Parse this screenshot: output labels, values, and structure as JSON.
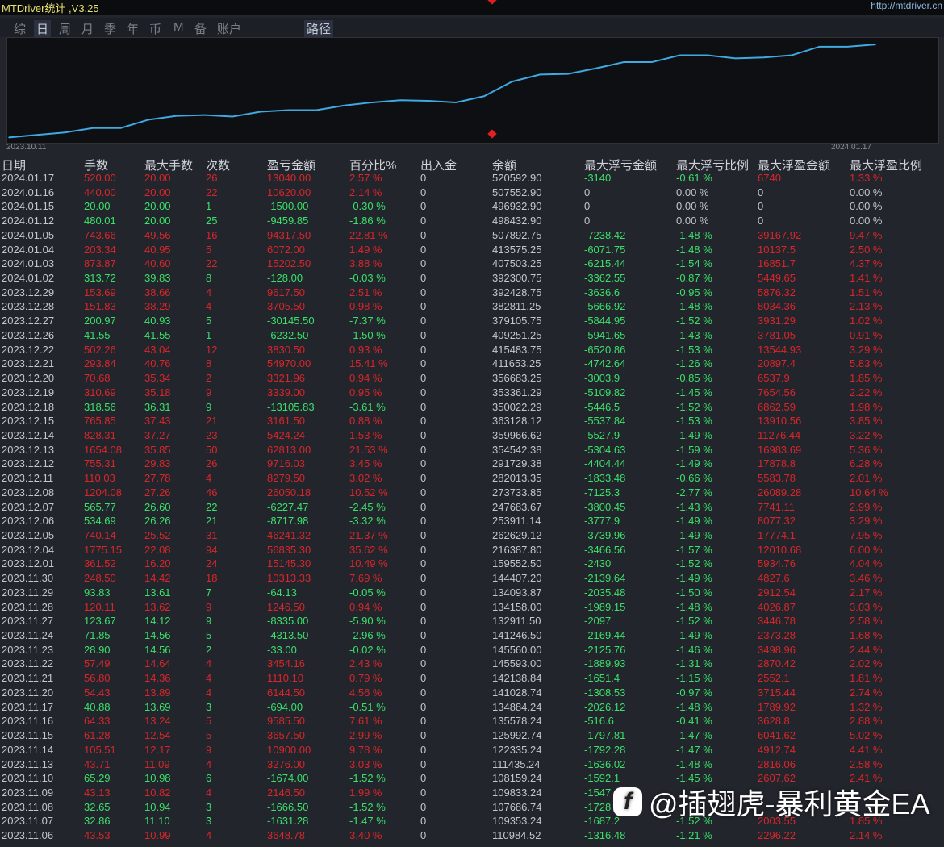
{
  "app": {
    "title": "MTDriver统计 ,V3.25",
    "link": "http://mtdriver.cn"
  },
  "tabs": [
    {
      "label": "综"
    },
    {
      "label": "日",
      "active": true
    },
    {
      "label": "周"
    },
    {
      "label": "月"
    },
    {
      "label": "季"
    },
    {
      "label": "年"
    },
    {
      "label": "币"
    },
    {
      "label": "M"
    },
    {
      "label": "备"
    },
    {
      "label": "账户"
    },
    {
      "label": "路径",
      "active": true
    }
  ],
  "chart_data": {
    "type": "line",
    "title": "",
    "xlabel": "",
    "ylabel": "余额",
    "x_start": "2023.10.11",
    "x_end": "2024.01.17",
    "line_color": "#3fa9e0",
    "values": [
      89500,
      101000,
      112000,
      132000,
      132000,
      170000,
      187000,
      191000,
      184000,
      206000,
      213000,
      213000,
      234000,
      248000,
      258000,
      255000,
      248000,
      276000,
      342000,
      374000,
      377000,
      402000,
      430000,
      430000,
      461000,
      461000,
      447000,
      451000,
      461000,
      500000,
      500000,
      510000
    ]
  },
  "watermark": "@插翅虎-暴利黄金EA",
  "table": {
    "headers": [
      "日期",
      "手数",
      "最大手数",
      "次数",
      "盈亏金额",
      "百分比%",
      "出入金",
      "余额",
      "最大浮亏金额",
      "最大浮亏比例",
      "最大浮盈金额",
      "最大浮盈比例"
    ],
    "rows": [
      [
        "2024.01.17",
        "520.00",
        "20.00",
        "26",
        "13040.00",
        "2.57 %",
        "0",
        "520592.90",
        "-3140",
        "-0.61 %",
        "6740",
        "1.33 %"
      ],
      [
        "2024.01.16",
        "440.00",
        "20.00",
        "22",
        "10620.00",
        "2.14 %",
        "0",
        "507552.90",
        "0",
        "0.00 %",
        "0",
        "0.00 %"
      ],
      [
        "2024.01.15",
        "20.00",
        "20.00",
        "1",
        "-1500.00",
        "-0.30 %",
        "0",
        "496932.90",
        "0",
        "0.00 %",
        "0",
        "0.00 %"
      ],
      [
        "2024.01.12",
        "480.01",
        "20.00",
        "25",
        "-9459.85",
        "-1.86 %",
        "0",
        "498432.90",
        "0",
        "0.00 %",
        "0",
        "0.00 %"
      ],
      [
        "2024.01.05",
        "743.66",
        "49.56",
        "16",
        "94317.50",
        "22.81 %",
        "0",
        "507892.75",
        "-7238.42",
        "-1.48 %",
        "39167.92",
        "9.47 %"
      ],
      [
        "2024.01.04",
        "203.34",
        "40.95",
        "5",
        "6072.00",
        "1.49 %",
        "0",
        "413575.25",
        "-6071.75",
        "-1.48 %",
        "10137.5",
        "2.50 %"
      ],
      [
        "2024.01.03",
        "873.87",
        "40.60",
        "22",
        "15202.50",
        "3.88 %",
        "0",
        "407503.25",
        "-6215.44",
        "-1.54 %",
        "16851.7",
        "4.37 %"
      ],
      [
        "2024.01.02",
        "313.72",
        "39.83",
        "8",
        "-128.00",
        "-0.03 %",
        "0",
        "392300.75",
        "-3362.55",
        "-0.87 %",
        "5449.65",
        "1.41 %"
      ],
      [
        "2023.12.29",
        "153.69",
        "38.66",
        "4",
        "9617.50",
        "2.51 %",
        "0",
        "392428.75",
        "-3636.6",
        "-0.95 %",
        "5876.32",
        "1.51 %"
      ],
      [
        "2023.12.28",
        "151.83",
        "38.29",
        "4",
        "3705.50",
        "0.98 %",
        "0",
        "382811.25",
        "-5666.92",
        "-1.48 %",
        "8034.36",
        "2.13 %"
      ],
      [
        "2023.12.27",
        "200.97",
        "40.93",
        "5",
        "-30145.50",
        "-7.37 %",
        "0",
        "379105.75",
        "-5844.95",
        "-1.52 %",
        "3931.29",
        "1.02 %"
      ],
      [
        "2023.12.26",
        "41.55",
        "41.55",
        "1",
        "-6232.50",
        "-1.50 %",
        "0",
        "409251.25",
        "-5941.65",
        "-1.43 %",
        "3781.05",
        "0.91 %"
      ],
      [
        "2023.12.22",
        "502.26",
        "43.04",
        "12",
        "3830.50",
        "0.93 %",
        "0",
        "415483.75",
        "-6520.86",
        "-1.53 %",
        "13544.93",
        "3.29 %"
      ],
      [
        "2023.12.21",
        "293.84",
        "40.76",
        "8",
        "54970.00",
        "15.41 %",
        "0",
        "411653.25",
        "-4742.64",
        "-1.26 %",
        "20897.4",
        "5.83 %"
      ],
      [
        "2023.12.20",
        "70.68",
        "35.34",
        "2",
        "3321.96",
        "0.94 %",
        "0",
        "356683.25",
        "-3003.9",
        "-0.85 %",
        "6537.9",
        "1.85 %"
      ],
      [
        "2023.12.19",
        "310.69",
        "35.18",
        "9",
        "3339.00",
        "0.95 %",
        "0",
        "353361.29",
        "-5109.82",
        "-1.45 %",
        "7654.56",
        "2.22 %"
      ],
      [
        "2023.12.18",
        "318.56",
        "36.31",
        "9",
        "-13105.83",
        "-3.61 %",
        "0",
        "350022.29",
        "-5446.5",
        "-1.52 %",
        "6862.59",
        "1.98 %"
      ],
      [
        "2023.12.15",
        "765.85",
        "37.43",
        "21",
        "3161.50",
        "0.88 %",
        "0",
        "363128.12",
        "-5537.84",
        "-1.53 %",
        "13910.56",
        "3.85 %"
      ],
      [
        "2023.12.14",
        "828.31",
        "37.27",
        "23",
        "5424.24",
        "1.53 %",
        "0",
        "359966.62",
        "-5527.9",
        "-1.49 %",
        "11276.44",
        "3.22 %"
      ],
      [
        "2023.12.13",
        "1654.08",
        "35.85",
        "50",
        "62813.00",
        "21.53 %",
        "0",
        "354542.38",
        "-5304.63",
        "-1.59 %",
        "16983.69",
        "5.36 %"
      ],
      [
        "2023.12.12",
        "755.31",
        "29.83",
        "26",
        "9716.03",
        "3.45 %",
        "0",
        "291729.38",
        "-4404.44",
        "-1.49 %",
        "17878.8",
        "6.28 %"
      ],
      [
        "2023.12.11",
        "110.03",
        "27.78",
        "4",
        "8279.50",
        "3.02 %",
        "0",
        "282013.35",
        "-1833.48",
        "-0.66 %",
        "5583.78",
        "2.01 %"
      ],
      [
        "2023.12.08",
        "1204.08",
        "27.26",
        "46",
        "26050.18",
        "10.52 %",
        "0",
        "273733.85",
        "-7125.3",
        "-2.77 %",
        "26089.28",
        "10.64 %"
      ],
      [
        "2023.12.07",
        "565.77",
        "26.60",
        "22",
        "-6227.47",
        "-2.45 %",
        "0",
        "247683.67",
        "-3800.45",
        "-1.43 %",
        "7741.11",
        "2.99 %"
      ],
      [
        "2023.12.06",
        "534.69",
        "26.26",
        "21",
        "-8717.98",
        "-3.32 %",
        "0",
        "253911.14",
        "-3777.9",
        "-1.49 %",
        "8077.32",
        "3.29 %"
      ],
      [
        "2023.12.05",
        "740.14",
        "25.52",
        "31",
        "46241.32",
        "21.37 %",
        "0",
        "262629.12",
        "-3739.96",
        "-1.49 %",
        "17774.1",
        "7.95 %"
      ],
      [
        "2023.12.04",
        "1775.15",
        "22.08",
        "94",
        "56835.30",
        "35.62 %",
        "0",
        "216387.80",
        "-3466.56",
        "-1.57 %",
        "12010.68",
        "6.00 %"
      ],
      [
        "2023.12.01",
        "361.52",
        "16.20",
        "24",
        "15145.30",
        "10.49 %",
        "0",
        "159552.50",
        "-2430",
        "-1.52 %",
        "5934.76",
        "4.04 %"
      ],
      [
        "2023.11.30",
        "248.50",
        "14.42",
        "18",
        "10313.33",
        "7.69 %",
        "0",
        "144407.20",
        "-2139.64",
        "-1.49 %",
        "4827.6",
        "3.46 %"
      ],
      [
        "2023.11.29",
        "93.83",
        "13.61",
        "7",
        "-64.13",
        "-0.05 %",
        "0",
        "134093.87",
        "-2035.48",
        "-1.50 %",
        "2912.54",
        "2.17 %"
      ],
      [
        "2023.11.28",
        "120.11",
        "13.62",
        "9",
        "1246.50",
        "0.94 %",
        "0",
        "134158.00",
        "-1989.15",
        "-1.48 %",
        "4026.87",
        "3.03 %"
      ],
      [
        "2023.11.27",
        "123.67",
        "14.12",
        "9",
        "-8335.00",
        "-5.90 %",
        "0",
        "132911.50",
        "-2097",
        "-1.52 %",
        "3446.78",
        "2.58 %"
      ],
      [
        "2023.11.24",
        "71.85",
        "14.56",
        "5",
        "-4313.50",
        "-2.96 %",
        "0",
        "141246.50",
        "-2169.44",
        "-1.49 %",
        "2373.28",
        "1.68 %"
      ],
      [
        "2023.11.23",
        "28.90",
        "14.56",
        "2",
        "-33.00",
        "-0.02 %",
        "0",
        "145560.00",
        "-2125.76",
        "-1.46 %",
        "3498.96",
        "2.44 %"
      ],
      [
        "2023.11.22",
        "57.49",
        "14.64",
        "4",
        "3454.16",
        "2.43 %",
        "0",
        "145593.00",
        "-1889.93",
        "-1.31 %",
        "2870.42",
        "2.02 %"
      ],
      [
        "2023.11.21",
        "56.80",
        "14.36",
        "4",
        "1110.10",
        "0.79 %",
        "0",
        "142138.84",
        "-1651.4",
        "-1.15 %",
        "2552.1",
        "1.81 %"
      ],
      [
        "2023.11.20",
        "54.43",
        "13.89",
        "4",
        "6144.50",
        "4.56 %",
        "0",
        "141028.74",
        "-1308.53",
        "-0.97 %",
        "3715.44",
        "2.74 %"
      ],
      [
        "2023.11.17",
        "40.88",
        "13.69",
        "3",
        "-694.00",
        "-0.51 %",
        "0",
        "134884.24",
        "-2026.12",
        "-1.48 %",
        "1789.92",
        "1.32 %"
      ],
      [
        "2023.11.16",
        "64.33",
        "13.24",
        "5",
        "9585.50",
        "7.61 %",
        "0",
        "135578.24",
        "-516.6",
        "-0.41 %",
        "3628.8",
        "2.88 %"
      ],
      [
        "2023.11.15",
        "61.28",
        "12.54",
        "5",
        "3657.50",
        "2.99 %",
        "0",
        "125992.74",
        "-1797.81",
        "-1.47 %",
        "6041.62",
        "5.02 %"
      ],
      [
        "2023.11.14",
        "105.51",
        "12.17",
        "9",
        "10900.00",
        "9.78 %",
        "0",
        "122335.24",
        "-1792.28",
        "-1.47 %",
        "4912.74",
        "4.41 %"
      ],
      [
        "2023.11.13",
        "43.71",
        "11.09",
        "4",
        "3276.00",
        "3.03 %",
        "0",
        "111435.24",
        "-1636.02",
        "-1.48 %",
        "2816.06",
        "2.58 %"
      ],
      [
        "2023.11.10",
        "65.29",
        "10.98",
        "6",
        "-1674.00",
        "-1.52 %",
        "0",
        "108159.24",
        "-1592.1",
        "-1.45 %",
        "2607.62",
        "2.41 %"
      ],
      [
        "2023.11.09",
        "43.13",
        "10.82",
        "4",
        "2146.50",
        "1.99 %",
        "0",
        "109833.24",
        "-1547",
        "",
        "",
        ""
      ],
      [
        "2023.11.08",
        "32.65",
        "10.94",
        "3",
        "-1666.50",
        "-1.52 %",
        "0",
        "107686.74",
        "-1728",
        "",
        "",
        ""
      ],
      [
        "2023.11.07",
        "32.86",
        "11.10",
        "3",
        "-1631.28",
        "-1.47 %",
        "0",
        "109353.24",
        "-1687.2",
        "-1.52 %",
        "2003.55",
        "1.85 %"
      ],
      [
        "2023.11.06",
        "43.53",
        "10.99",
        "4",
        "3648.78",
        "3.40 %",
        "0",
        "110984.52",
        "-1316.48",
        "-1.21 %",
        "2296.22",
        "2.14 %"
      ]
    ]
  }
}
